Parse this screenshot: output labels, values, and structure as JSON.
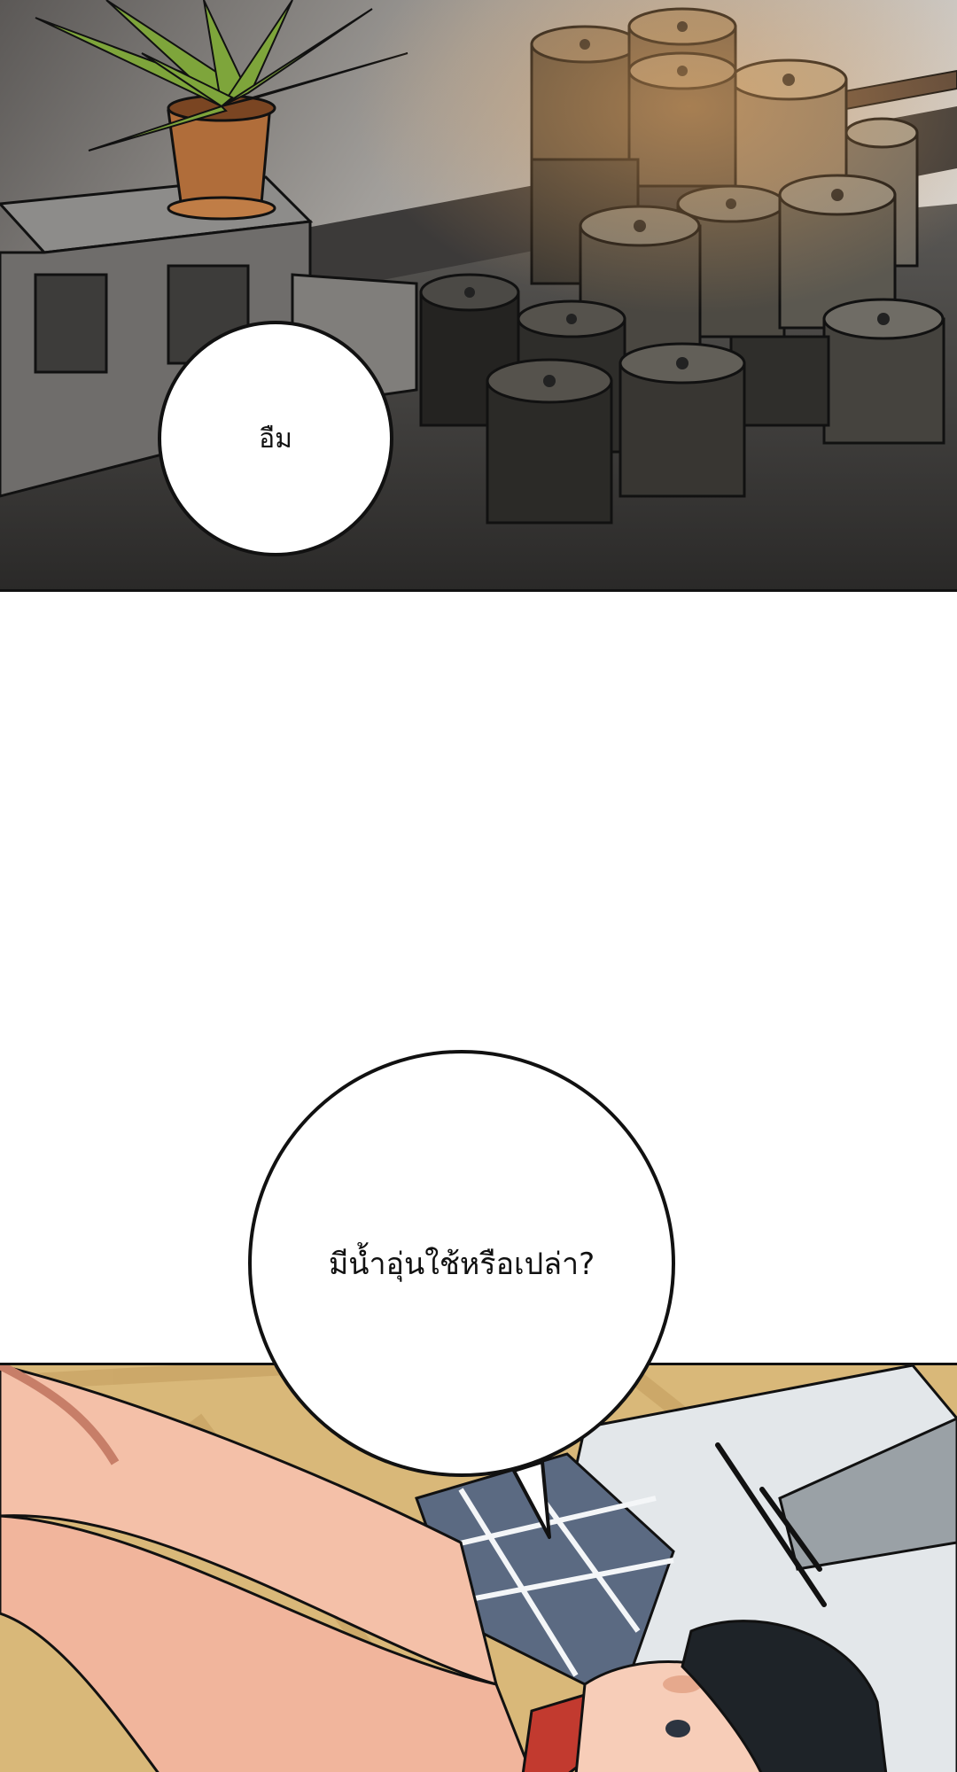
{
  "panels": [
    {
      "scene": "briquettes",
      "bubble_text": "อืม"
    },
    {
      "scene": "boy-lying-down",
      "bubble_text": "มีน้ำอุ่นใช้หรือเปล่า?"
    }
  ],
  "colors": {
    "ink": "#111111",
    "wall": "#8a8886",
    "floor": "#3a3a3a",
    "briquette_light": "#6d6a60",
    "briquette_dark": "#2c2b28",
    "plant_leaf": "#7ea53b",
    "pot": "#b06d3a",
    "wood_floor": "#d9b879",
    "skin": "#f4c0a8",
    "shirt": "#5b6a82",
    "hair": "#1e2328",
    "pillow": "#e3e7ea"
  }
}
